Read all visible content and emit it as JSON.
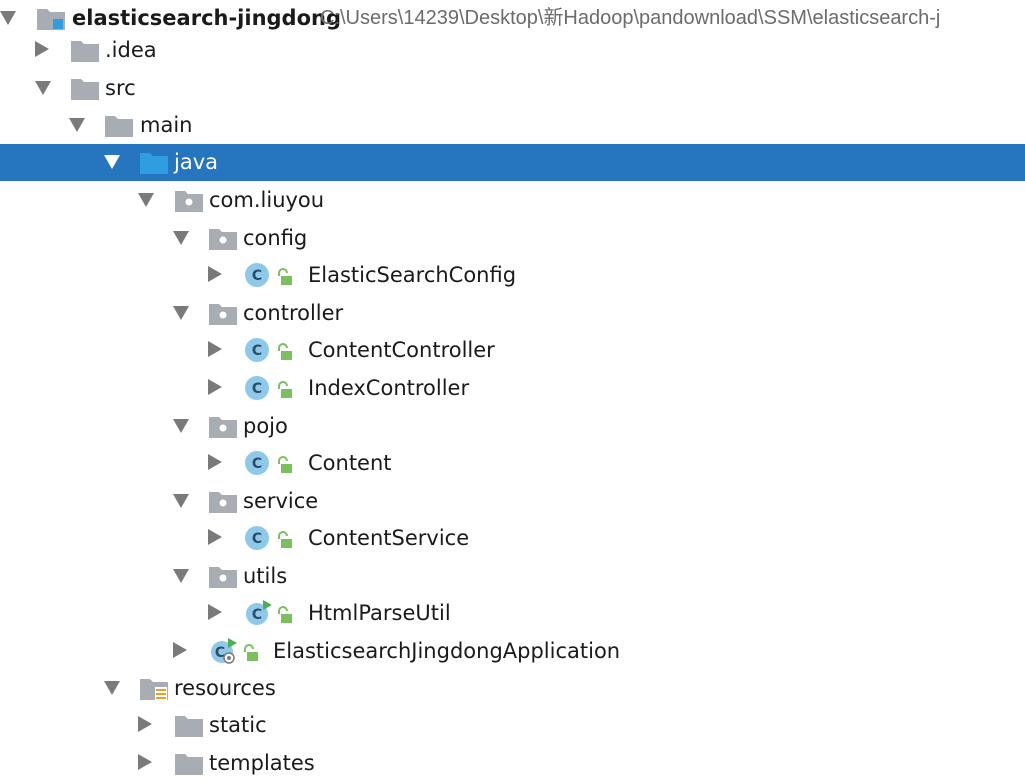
{
  "project": {
    "name": "elasticsearch-jingdong",
    "path": "C:\\Users\\14239\\Desktop\\新Hadoop\\pandownload\\SSM\\elasticsearch-j"
  },
  "nodes": [
    {
      "label": "elasticsearch-jingdong",
      "type": "project-folder",
      "expanded": true
    },
    {
      "label": ".idea",
      "type": "folder",
      "expanded": false
    },
    {
      "label": "src",
      "type": "folder",
      "expanded": true
    },
    {
      "label": "main",
      "type": "folder",
      "expanded": true
    },
    {
      "label": "java",
      "type": "source-folder",
      "expanded": true,
      "selected": true
    },
    {
      "label": "com.liuyou",
      "type": "package",
      "expanded": true
    },
    {
      "label": "config",
      "type": "package",
      "expanded": true
    },
    {
      "label": "ElasticSearchConfig",
      "type": "class",
      "expanded": false
    },
    {
      "label": "controller",
      "type": "package",
      "expanded": true
    },
    {
      "label": "ContentController",
      "type": "class",
      "expanded": false
    },
    {
      "label": "IndexController",
      "type": "class",
      "expanded": false
    },
    {
      "label": "pojo",
      "type": "package",
      "expanded": true
    },
    {
      "label": "Content",
      "type": "class",
      "expanded": false
    },
    {
      "label": "service",
      "type": "package",
      "expanded": true
    },
    {
      "label": "ContentService",
      "type": "class",
      "expanded": false
    },
    {
      "label": "utils",
      "type": "package",
      "expanded": true
    },
    {
      "label": "HtmlParseUtil",
      "type": "runnable-class",
      "expanded": false
    },
    {
      "label": "ElasticsearchJingdongApplication",
      "type": "spring-boot-class",
      "expanded": false
    },
    {
      "label": "resources",
      "type": "resources-folder",
      "expanded": true
    },
    {
      "label": "static",
      "type": "folder",
      "expanded": false
    },
    {
      "label": "templates",
      "type": "folder",
      "expanded": false
    }
  ],
  "colors": {
    "selection": "#2675bf",
    "folder": "#a8adb3",
    "source_folder": "#2f9de0",
    "class_badge": "#8ec9ea",
    "lock": "#7bbf5e",
    "run_badge": "#4caf50"
  }
}
